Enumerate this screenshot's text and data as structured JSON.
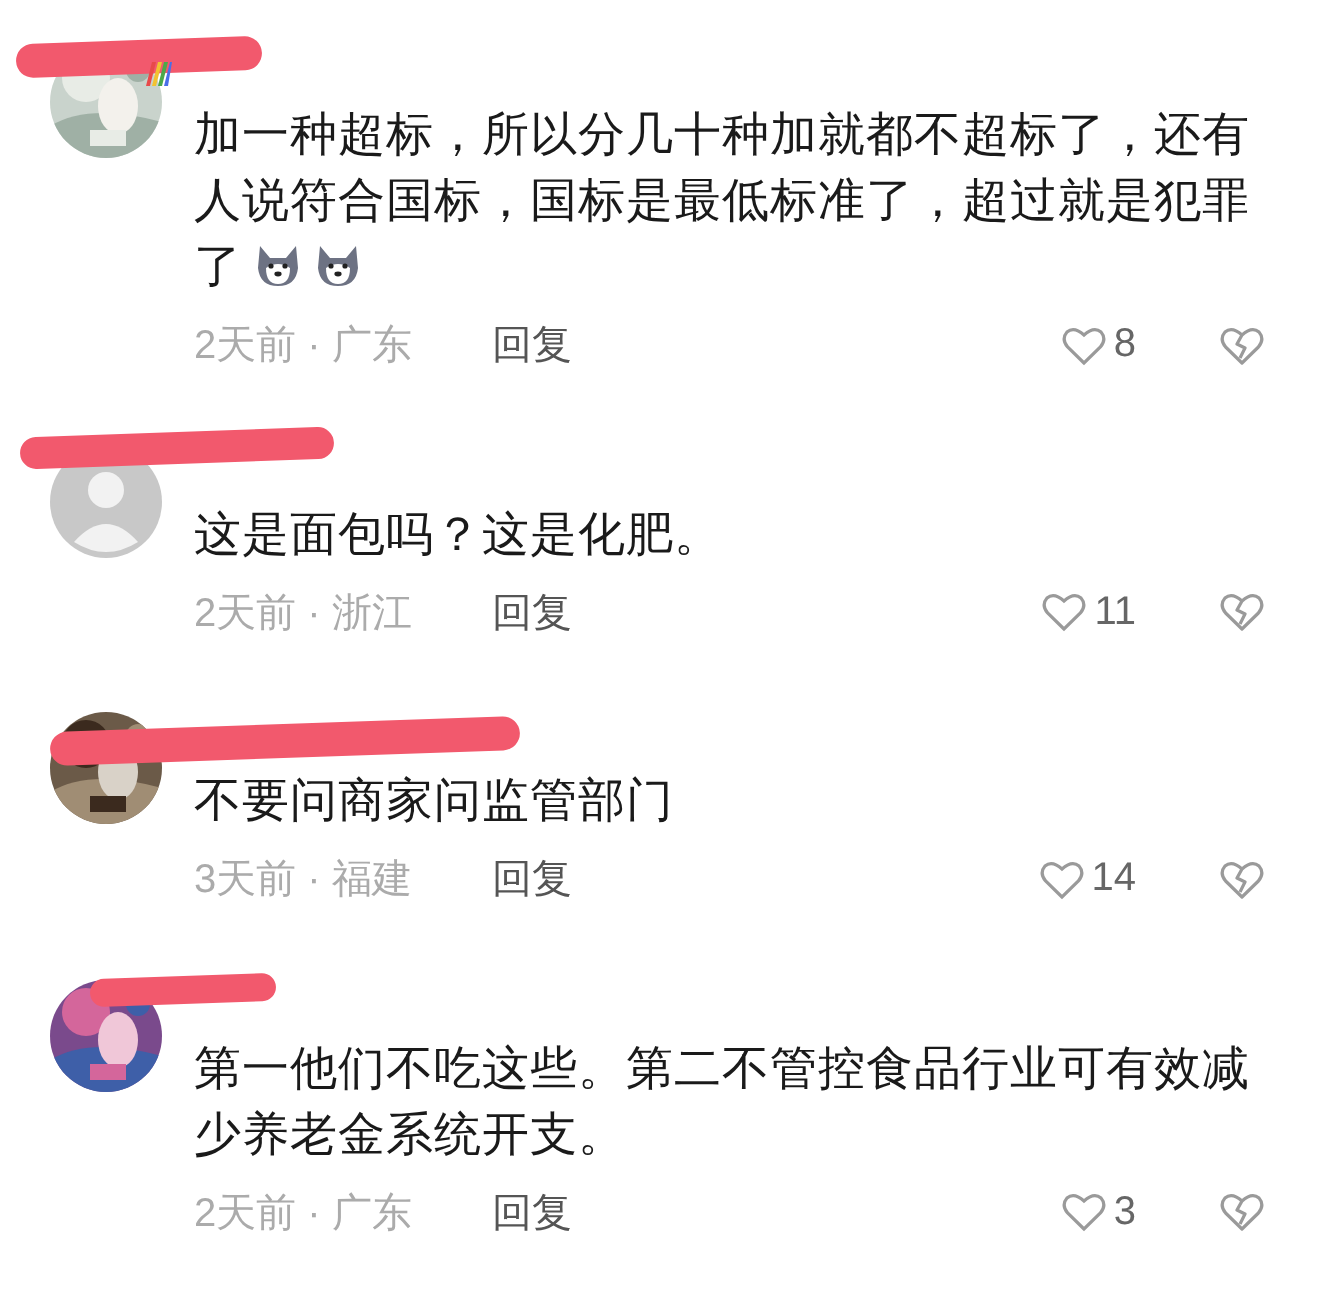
{
  "comments": [
    {
      "avatar": {
        "kind": "picture"
      },
      "badge": {
        "kind": "rainbow"
      },
      "lines": [
        "加一种超标，所以分几十种加就都不超标了，还有",
        "人说符合国标，国标是最低标准了，超过就是犯罪",
        "了"
      ],
      "emojis": [
        {
          "kind": "dog"
        },
        {
          "kind": "dog"
        }
      ],
      "meta": "2天前 · 广东",
      "reply": "回复",
      "likes": "8"
    },
    {
      "avatar": {
        "kind": "default"
      },
      "lines": [
        "这是面包吗？这是化肥。"
      ],
      "meta": "2天前 · 浙江",
      "reply": "回复",
      "likes": "11"
    },
    {
      "avatar": {
        "kind": "picture"
      },
      "lines": [
        "不要问商家问监管部门"
      ],
      "meta": "3天前 · 福建",
      "reply": "回复",
      "likes": "14"
    },
    {
      "avatar": {
        "kind": "picture"
      },
      "lines": [
        "第一他们不吃这些。第二不管控食品行业可有效减",
        "少养老金系统开支。"
      ],
      "meta": "2天前 · 广东",
      "reply": "回复",
      "likes": "3"
    }
  ]
}
